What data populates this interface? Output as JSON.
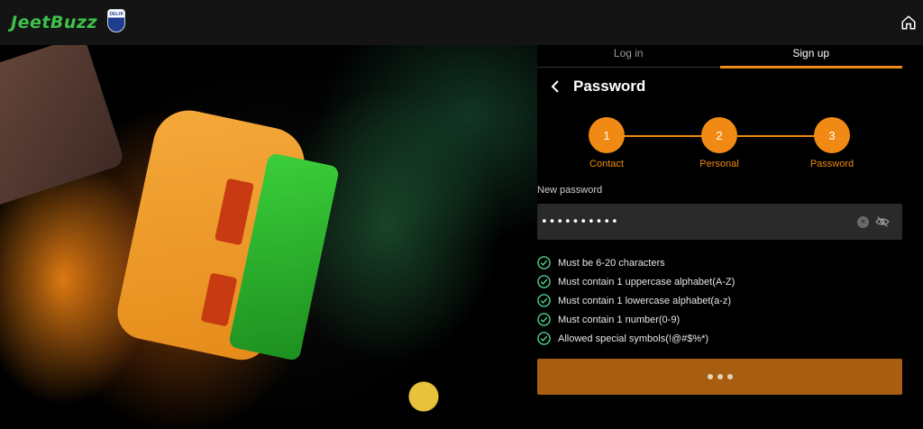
{
  "header": {
    "brand": "JeetBuzz",
    "badge_text": "DELHI",
    "home_icon": "home-icon"
  },
  "auth": {
    "tabs": [
      {
        "label": "Log in",
        "active": false
      },
      {
        "label": "Sign up",
        "active": true
      }
    ],
    "title": "Password",
    "steps": [
      {
        "number": "1",
        "label": "Contact"
      },
      {
        "number": "2",
        "label": "Personal"
      },
      {
        "number": "3",
        "label": "Password"
      }
    ],
    "password": {
      "label": "New password",
      "value": "••••••••••"
    },
    "rules": [
      "Must be 6-20 characters",
      "Must contain 1 uppercase alphabet(A-Z)",
      "Must contain 1 lowercase alphabet(a-z)",
      "Must contain 1 number(0-9)",
      "Allowed special symbols(!@#$%*)"
    ],
    "accent_color": "#f08a14",
    "check_color": "#4fcf8f"
  }
}
